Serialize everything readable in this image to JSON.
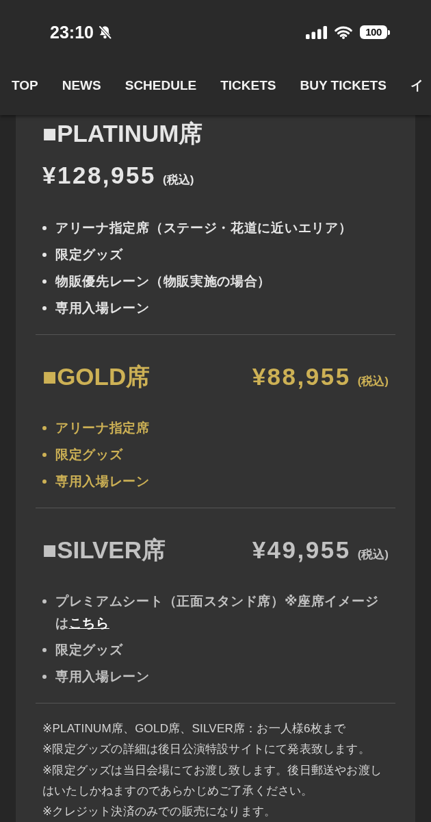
{
  "status_bar": {
    "time": "23:10",
    "battery": "100"
  },
  "nav": [
    {
      "label": "TOP"
    },
    {
      "label": "NEWS"
    },
    {
      "label": "SCHEDULE"
    },
    {
      "label": "TICKETS"
    },
    {
      "label": "BUY TICKETS"
    },
    {
      "label": "イ"
    }
  ],
  "tiers": [
    {
      "kind": "stacked",
      "color": "#e6e6e6",
      "title": "■PLATINUM席",
      "price": "¥128,955",
      "tax": "(税込)",
      "features": [
        {
          "text": "アリーナ指定席（ステージ・花道に近いエリア）"
        },
        {
          "text": "限定グッズ"
        },
        {
          "text": "物販優先レーン（物販実施の場合）"
        },
        {
          "text": "専用入場レーン"
        }
      ]
    },
    {
      "kind": "inline",
      "color": "#cdb155",
      "title": "■GOLD席",
      "price": "¥88,955",
      "tax": "(税込)",
      "features": [
        {
          "text": "アリーナ指定席"
        },
        {
          "text": "限定グッズ"
        },
        {
          "text": "専用入場レーン"
        }
      ]
    },
    {
      "kind": "inline",
      "color": "#c2c2c2",
      "title": "■SILVER席",
      "price": "¥49,955",
      "tax": "(税込)",
      "features": [
        {
          "text": "プレミアムシート（正面スタンド席）※座席イメージは",
          "link": "こちら"
        },
        {
          "text": "限定グッズ"
        },
        {
          "text": "専用入場レーン"
        }
      ]
    }
  ],
  "notes": [
    "※PLATINUM席、GOLD席、SILVER席：お一人様6枚まで",
    "※限定グッズの詳細は後日公演特設サイトにて発表致します。",
    "※限定グッズは当日会場にてお渡し致します。後日郵送やお渡しはいたしかねますのであらかじめご了承ください。",
    "※クレジット決済のみでの販売になります。"
  ]
}
